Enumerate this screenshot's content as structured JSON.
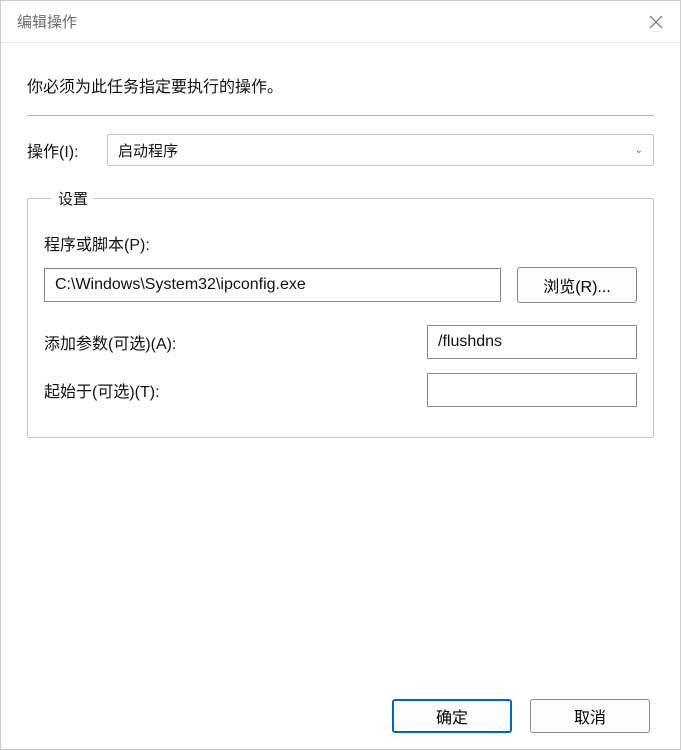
{
  "titlebar": {
    "title": "编辑操作"
  },
  "instruction": "你必须为此任务指定要执行的操作。",
  "action": {
    "label": "操作(I):",
    "value": "启动程序"
  },
  "settings": {
    "legend": "设置",
    "program": {
      "label": "程序或脚本(P):",
      "value": "C:\\Windows\\System32\\ipconfig.exe",
      "browse": "浏览(R)..."
    },
    "arguments": {
      "label": "添加参数(可选)(A):",
      "value": "/flushdns"
    },
    "startin": {
      "label": "起始于(可选)(T):",
      "value": ""
    }
  },
  "buttons": {
    "ok": "确定",
    "cancel": "取消"
  }
}
